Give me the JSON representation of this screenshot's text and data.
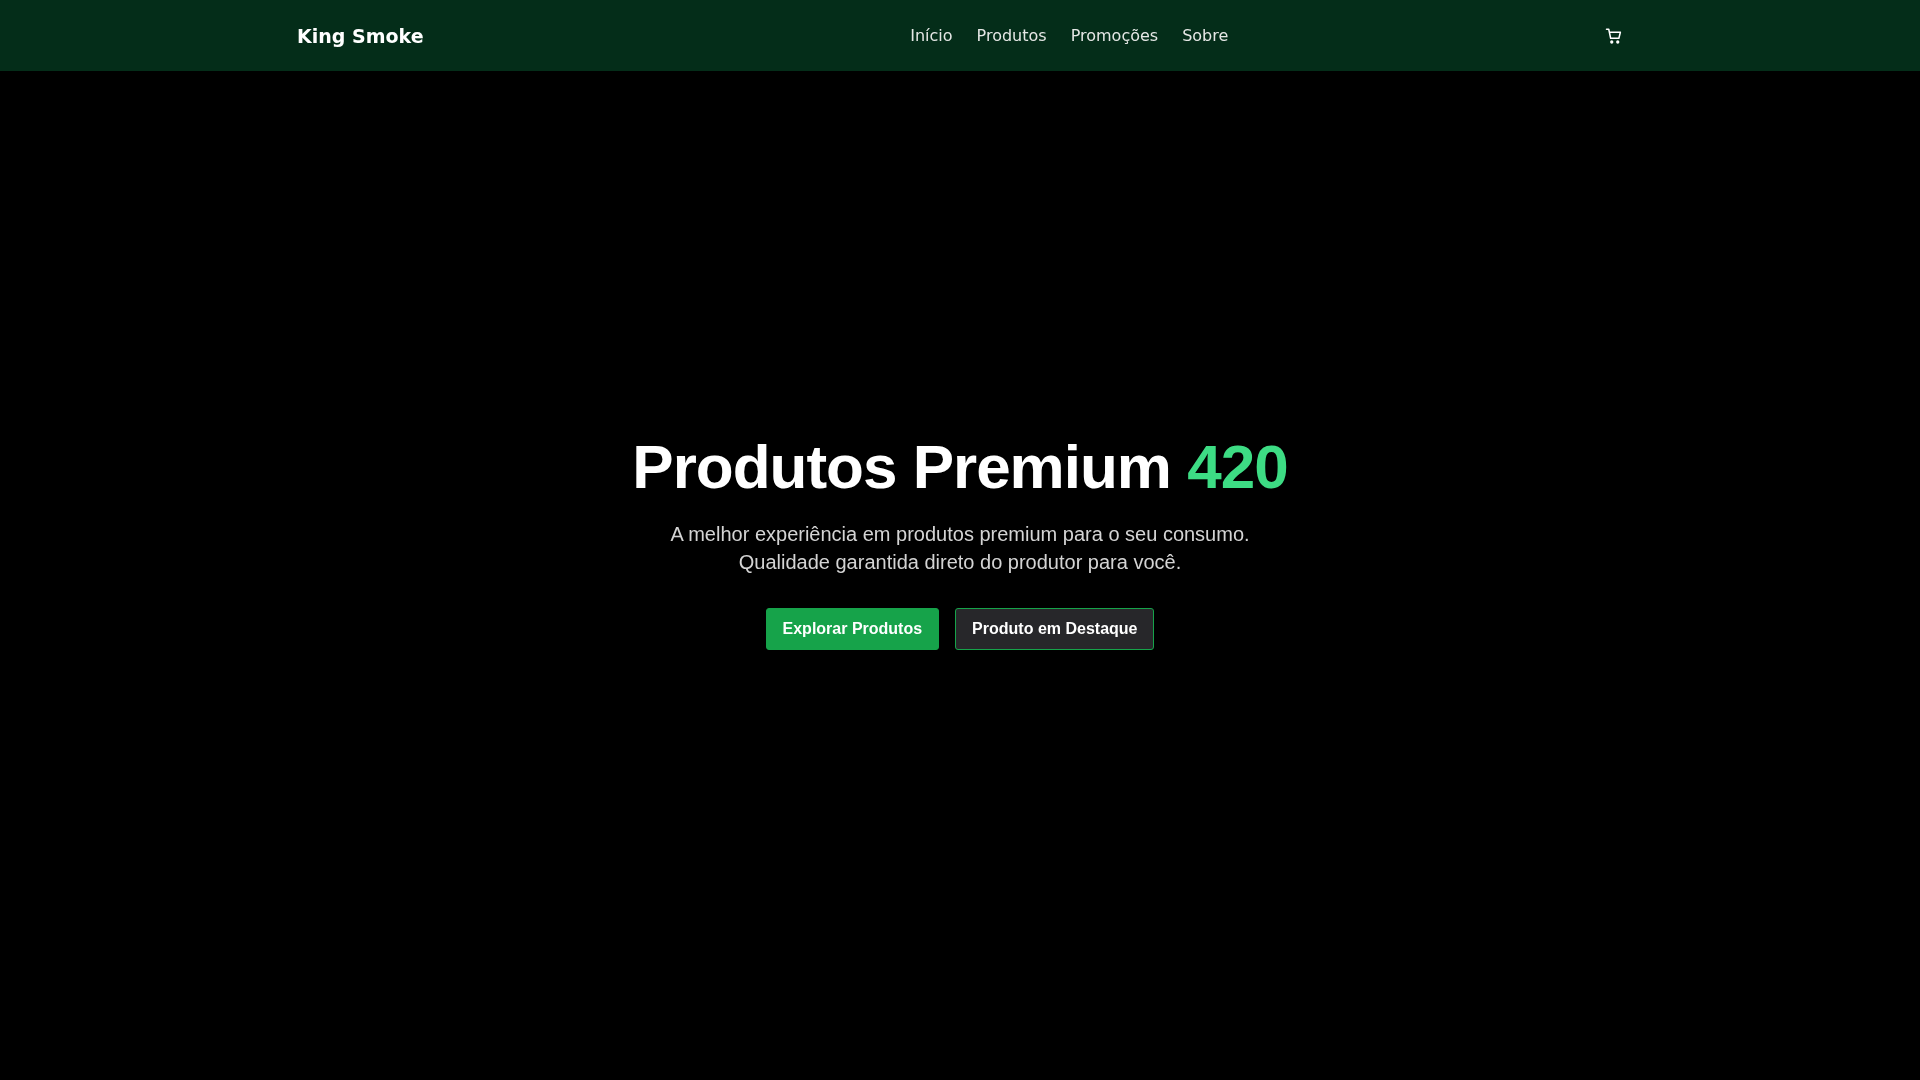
{
  "header": {
    "logo": "King Smoke",
    "nav": [
      {
        "label": "Início"
      },
      {
        "label": "Produtos"
      },
      {
        "label": "Promoções"
      },
      {
        "label": "Sobre"
      }
    ]
  },
  "hero": {
    "title": "Produtos Premium",
    "highlight": "420",
    "subtitle_lines": [
      "A melhor experiência em produtos premium para o seu consumo.",
      "Qualidade garantida direto do produtor para você."
    ],
    "buttons": [
      {
        "label": "Explorar Produtos",
        "kind": "primary"
      },
      {
        "label": "Produto em Destaque",
        "kind": "outline"
      }
    ]
  }
}
